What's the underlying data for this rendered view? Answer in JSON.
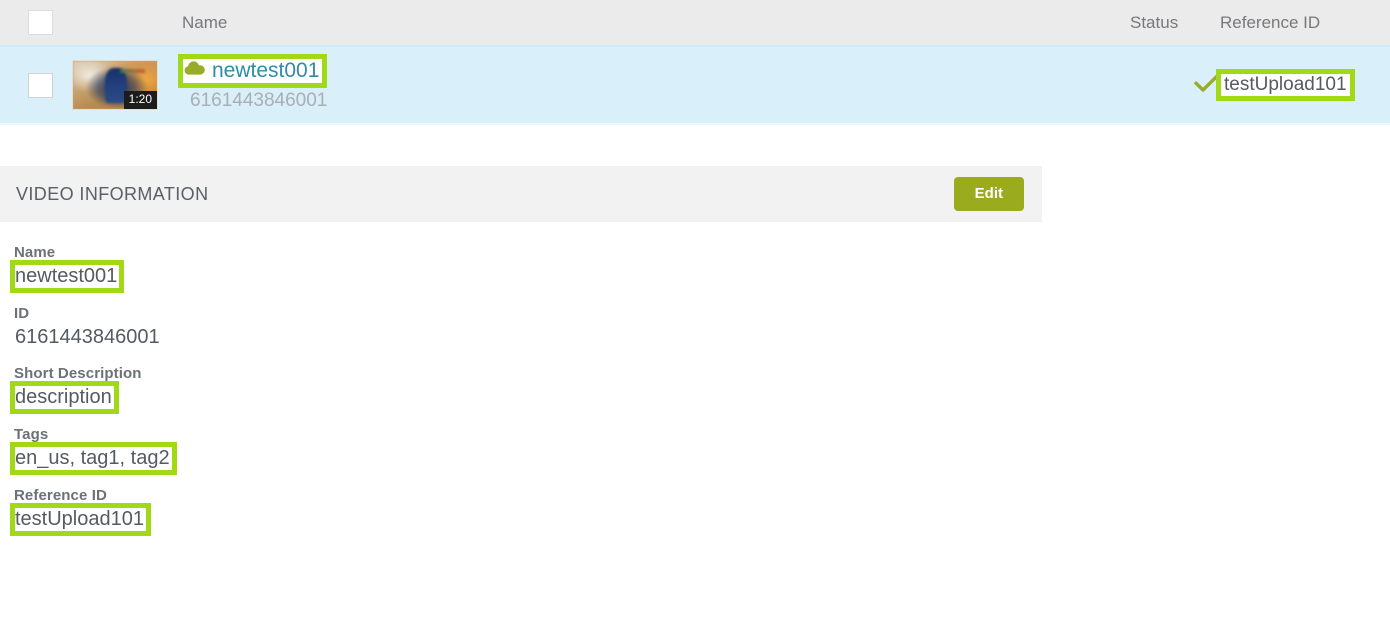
{
  "table": {
    "columns": {
      "select_all": "",
      "thumbnail": "",
      "name": "Name",
      "status": "Status",
      "reference_id": "Reference ID"
    },
    "rows": [
      {
        "selected": false,
        "thumbnail_duration": "1:20",
        "cloud_icon": "cloud-icon",
        "name": "newtest001",
        "id": "6161443846001",
        "status_icon": "check-icon",
        "reference_id": "testUpload101"
      }
    ]
  },
  "panel": {
    "title": "VIDEO INFORMATION",
    "edit_label": "Edit"
  },
  "fields": [
    {
      "label": "Name",
      "value": "newtest001",
      "highlighted": true
    },
    {
      "label": "ID",
      "value": "6161443846001",
      "highlighted": false
    },
    {
      "label": "Short Description",
      "value": "description",
      "highlighted": true
    },
    {
      "label": "Tags",
      "value": "en_us, tag1, tag2",
      "highlighted": true
    },
    {
      "label": "Reference ID",
      "value": "testUpload101",
      "highlighted": true
    }
  ],
  "colors": {
    "highlight": "#a2d916",
    "accent_olive": "#9aab1e",
    "link": "#2e8ca8",
    "row_background": "#d9eff9",
    "header_background": "#ebebeb",
    "panel_background": "#f2f2f2"
  }
}
